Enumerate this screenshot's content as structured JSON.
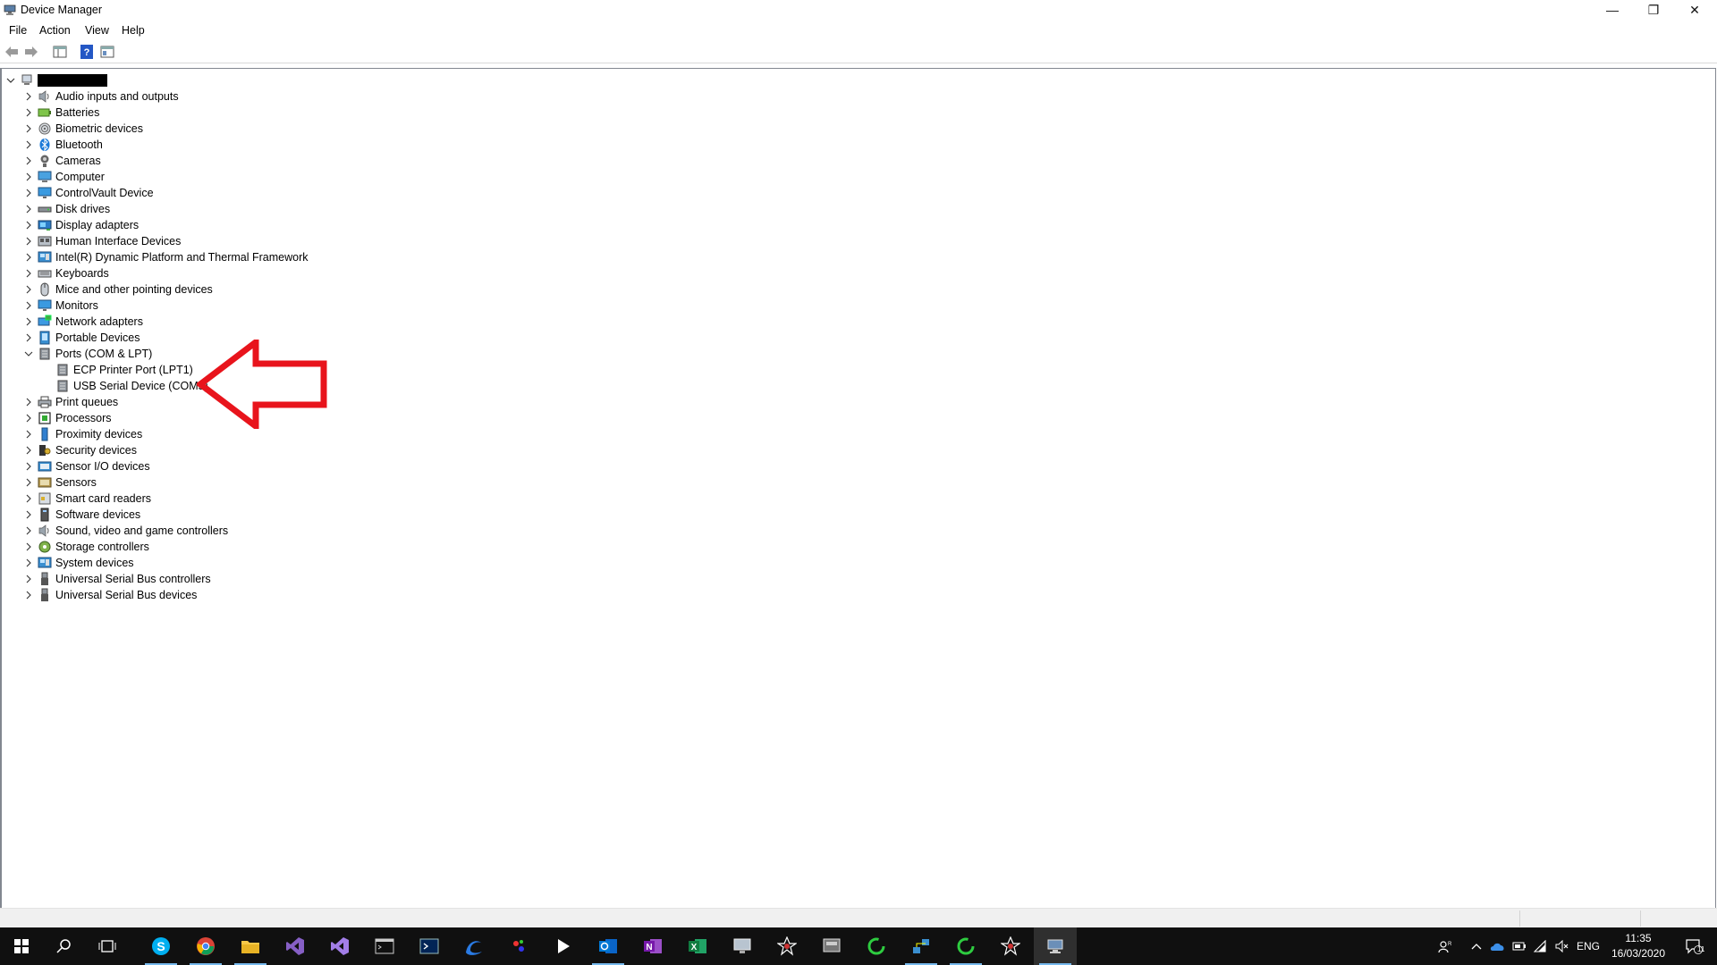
{
  "window": {
    "title": "Device Manager",
    "minimize": "—",
    "restore": "❐",
    "close": "✕"
  },
  "menu": [
    "File",
    "Action",
    "View",
    "Help"
  ],
  "tree": {
    "root_label": "",
    "categories": [
      {
        "label": "Audio inputs and outputs",
        "icon": "speaker-icon"
      },
      {
        "label": "Batteries",
        "icon": "battery-icon"
      },
      {
        "label": "Biometric devices",
        "icon": "fingerprint-icon"
      },
      {
        "label": "Bluetooth",
        "icon": "bluetooth-icon"
      },
      {
        "label": "Cameras",
        "icon": "camera-icon"
      },
      {
        "label": "Computer",
        "icon": "computer-icon"
      },
      {
        "label": "ControlVault Device",
        "icon": "monitor-icon"
      },
      {
        "label": "Disk drives",
        "icon": "disk-icon"
      },
      {
        "label": "Display adapters",
        "icon": "display-adapter-icon"
      },
      {
        "label": "Human Interface Devices",
        "icon": "hid-icon"
      },
      {
        "label": "Intel(R) Dynamic Platform and Thermal Framework",
        "icon": "system-device-icon"
      },
      {
        "label": "Keyboards",
        "icon": "keyboard-icon"
      },
      {
        "label": "Mice and other pointing devices",
        "icon": "mouse-icon"
      },
      {
        "label": "Monitors",
        "icon": "monitor-icon"
      },
      {
        "label": "Network adapters",
        "icon": "network-icon"
      },
      {
        "label": "Portable Devices",
        "icon": "portable-device-icon"
      },
      {
        "label": "Ports (COM & LPT)",
        "icon": "port-icon"
      }
    ],
    "ports_children": [
      "ECP Printer Port (LPT1)",
      "USB Serial Device (COM5)"
    ],
    "categories_after": [
      {
        "label": "Print queues",
        "icon": "printer-icon"
      },
      {
        "label": "Processors",
        "icon": "processor-icon"
      },
      {
        "label": "Proximity devices",
        "icon": "proximity-icon"
      },
      {
        "label": "Security devices",
        "icon": "security-icon"
      },
      {
        "label": "Sensor I/O devices",
        "icon": "sensor-io-icon"
      },
      {
        "label": "Sensors",
        "icon": "sensor-icon"
      },
      {
        "label": "Smart card readers",
        "icon": "smart-card-icon"
      },
      {
        "label": "Software devices",
        "icon": "software-device-icon"
      },
      {
        "label": "Sound, video and game controllers",
        "icon": "speaker-icon"
      },
      {
        "label": "Storage controllers",
        "icon": "storage-icon"
      },
      {
        "label": "System devices",
        "icon": "system-device-icon"
      },
      {
        "label": "Universal Serial Bus controllers",
        "icon": "usb-icon"
      },
      {
        "label": "Universal Serial Bus devices",
        "icon": "usb-icon"
      }
    ]
  },
  "taskbar": {
    "apps": [
      "start-icon",
      "search-icon",
      "task-view-icon",
      "skype-icon",
      "chrome-icon",
      "file-explorer-icon",
      "visual-studio-icon",
      "visual-studio-preview-icon",
      "terminal-icon",
      "powershell-icon",
      "edge-icon",
      "app-icon",
      "media-player-icon",
      "outlook-icon",
      "onenote-icon",
      "excel-icon",
      "remote-desktop-icon",
      "app-icon",
      "app-icon",
      "sync-icon",
      "network-tool-icon",
      "sync-icon",
      "app-icon",
      "device-manager-icon"
    ],
    "tray": {
      "lang": "ENG",
      "time": "11:35",
      "date": "16/03/2020",
      "notifications": "11"
    }
  },
  "colors": {
    "accent": "#0078d7",
    "arrow": "#e8141c",
    "taskbar": "#101010"
  }
}
